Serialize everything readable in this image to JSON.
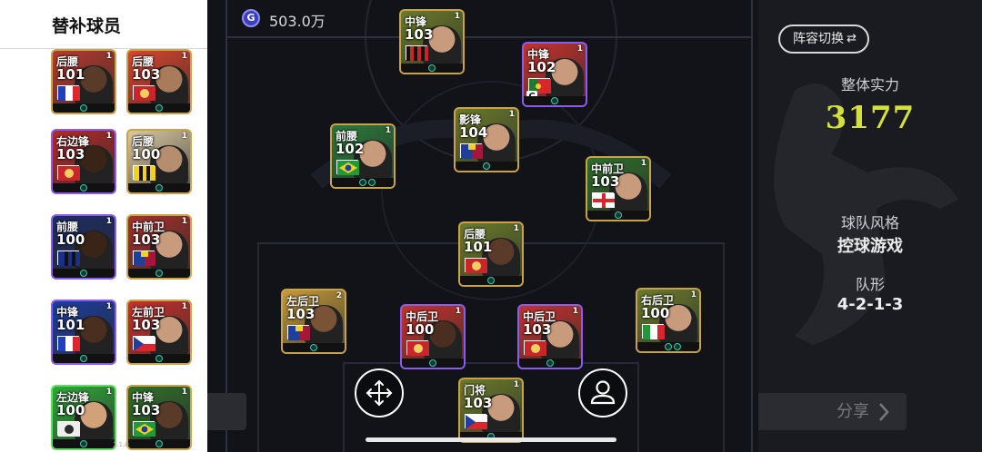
{
  "substitutes_panel": {
    "title": "替补球员",
    "version_text": "1.1.0"
  },
  "substitutes": [
    {
      "pos": "后腰",
      "rating": "101",
      "level": "1",
      "border": "#c9a34a",
      "bg": "#b53a2f",
      "face": "#5a3b2a",
      "flag": "fr",
      "dots": 1
    },
    {
      "pos": "后腰",
      "rating": "103",
      "level": "1",
      "border": "#c9a34a",
      "bg": "#d9442e",
      "face": "#a97b5a",
      "flag": "club-red",
      "dots": 1
    },
    {
      "pos": "右边锋",
      "rating": "103",
      "level": "1",
      "border": "#8a5cf0",
      "bg": "#b12a2a",
      "face": "#3a2418",
      "flag": "club-red",
      "dots": 1
    },
    {
      "pos": "后腰",
      "rating": "100",
      "level": "1",
      "border": "#c9a34a",
      "bg": "#d9c9a2",
      "face": "#b48e6e",
      "flag": "club-yb",
      "dots": 1
    },
    {
      "pos": "前腰",
      "rating": "100",
      "level": "1",
      "border": "#8a5cf0",
      "bg": "#1c2c64",
      "face": "#3a2418",
      "flag": "club-blue",
      "dots": 1
    },
    {
      "pos": "中前卫",
      "rating": "103",
      "level": "1",
      "border": "#c9a34a",
      "bg": "#a3302c",
      "face": "#c79b7c",
      "flag": "club-barca",
      "dots": 1
    },
    {
      "pos": "中锋",
      "rating": "101",
      "level": "1",
      "border": "#8a5cf0",
      "bg": "#1d3c9c",
      "face": "#4a2e20",
      "flag": "fr",
      "dots": 1
    },
    {
      "pos": "左前卫",
      "rating": "103",
      "level": "1",
      "border": "#c9a34a",
      "bg": "#c8302c",
      "face": "#c79b7c",
      "flag": "cz",
      "dots": 1
    },
    {
      "pos": "左边锋",
      "rating": "100",
      "level": "1",
      "border": "#5ae05a",
      "bg": "#2fa83a",
      "face": "#d1a27a",
      "flag": "club-white",
      "dots": 1
    },
    {
      "pos": "中锋",
      "rating": "103",
      "level": "1",
      "border": "#c9a34a",
      "bg": "#2f6e2a",
      "face": "#5a3b2a",
      "flag": "br",
      "dots": 1
    }
  ],
  "gp": {
    "icon_letter": "G",
    "value": "503.0万"
  },
  "starters": [
    {
      "id": "st-top",
      "pos": "中锋",
      "rating": "103",
      "level": "1",
      "border": "#c9a34a",
      "bg": "#6a7a2a",
      "face": "#c79b7c",
      "flag": "club-acm",
      "dots": 1
    },
    {
      "id": "st-right",
      "pos": "中锋",
      "rating": "102",
      "level": "1",
      "border": "#8a5cf0",
      "bg": "#c5322c",
      "face": "#c79b7c",
      "flag": "pt",
      "dots": 1,
      "badge": "C"
    },
    {
      "id": "am-left",
      "pos": "前腰",
      "rating": "102",
      "level": "1",
      "border": "#c9a34a",
      "bg": "#2a7a3a",
      "face": "#c79b7c",
      "flag": "br",
      "dots": 2
    },
    {
      "id": "ss",
      "pos": "影锋",
      "rating": "104",
      "level": "1",
      "border": "#c9a34a",
      "bg": "#6a7a2a",
      "face": "#c79b7c",
      "flag": "club-barca",
      "dots": 1
    },
    {
      "id": "cm-right",
      "pos": "中前卫",
      "rating": "103",
      "level": "1",
      "border": "#c9a34a",
      "bg": "#2f6e2a",
      "face": "#c79b7c",
      "flag": "en",
      "dots": 1
    },
    {
      "id": "dmf",
      "pos": "后腰",
      "rating": "101",
      "level": "1",
      "border": "#c9a34a",
      "bg": "#6a7a2a",
      "face": "#5a3b2a",
      "flag": "club-red",
      "dots": 1
    },
    {
      "id": "lb",
      "pos": "左后卫",
      "rating": "103",
      "level": "2",
      "border": "#c9a34a",
      "bg": "#c49a3a",
      "face": "#7a5236",
      "flag": "club-barca",
      "dots": 1
    },
    {
      "id": "cb-left",
      "pos": "中后卫",
      "rating": "100",
      "level": "1",
      "border": "#8a5cf0",
      "bg": "#c5322c",
      "face": "#4a2e20",
      "flag": "club-red",
      "dots": 1
    },
    {
      "id": "cb-right",
      "pos": "中后卫",
      "rating": "103",
      "level": "1",
      "border": "#8a5cf0",
      "bg": "#c5322c",
      "face": "#c79b7c",
      "flag": "club-red",
      "dots": 1
    },
    {
      "id": "rb",
      "pos": "右后卫",
      "rating": "100",
      "level": "1",
      "border": "#c9a34a",
      "bg": "#6a7a2a",
      "face": "#c79b7c",
      "flag": "it",
      "dots": 2
    },
    {
      "id": "gk",
      "pos": "门将",
      "rating": "103",
      "level": "1",
      "border": "#c9a34a",
      "bg": "#6a7a2a",
      "face": "#c79b7c",
      "flag": "cz",
      "dots": 1
    }
  ],
  "right_panel": {
    "swap_label": "阵容切换",
    "swap_icon": "⇄",
    "strength_label": "整体实力",
    "strength_value": "3177",
    "style_label": "球队风格",
    "style_value": "控球游戏",
    "formation_label": "队形",
    "formation_value": "4-2-1-3",
    "share_label": "分享",
    "share_icon": "chevron-right-icon"
  },
  "controls": {
    "move_icon": "move-arrows-icon",
    "profile_icon": "person-icon"
  }
}
